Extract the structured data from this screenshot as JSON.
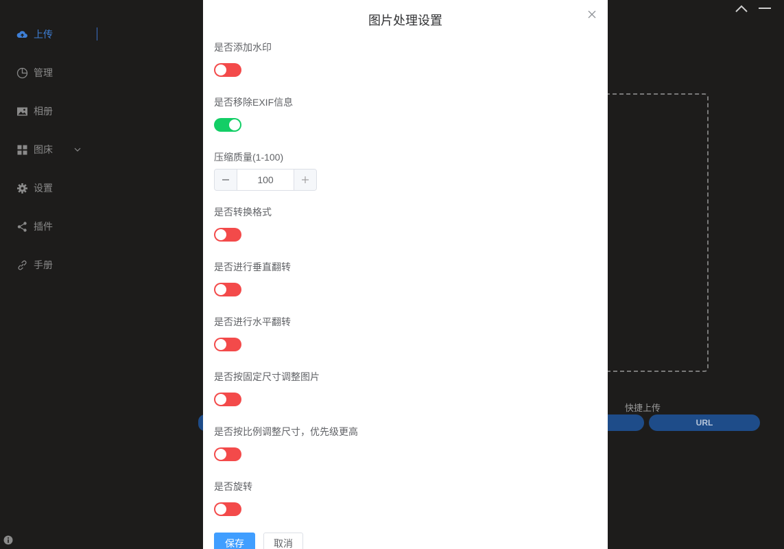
{
  "sidebar": {
    "items": [
      {
        "label": "上传",
        "icon": "cloud-upload-icon"
      },
      {
        "label": "管理",
        "icon": "pie-chart-icon"
      },
      {
        "label": "相册",
        "icon": "image-icon"
      },
      {
        "label": "图床",
        "icon": "grid-icon"
      },
      {
        "label": "设置",
        "icon": "gear-icon"
      },
      {
        "label": "插件",
        "icon": "share-icon"
      },
      {
        "label": "手册",
        "icon": "link-icon"
      }
    ],
    "active_color": "#3e7fd6"
  },
  "upload": {
    "quick_label": "快捷上传",
    "url_button": "URL"
  },
  "modal": {
    "title": "图片处理设置",
    "settings": [
      {
        "label": "是否添加水印",
        "enabled": false
      },
      {
        "label": "是否移除EXIF信息",
        "enabled": true
      },
      {
        "label": "压缩质量(1-100)",
        "value": "100"
      },
      {
        "label": "是否转换格式",
        "enabled": false
      },
      {
        "label": "是否进行垂直翻转",
        "enabled": false
      },
      {
        "label": "是否进行水平翻转",
        "enabled": false
      },
      {
        "label": "是否按固定尺寸调整图片",
        "enabled": false
      },
      {
        "label": "是否按比例调整尺寸，优先级更高",
        "enabled": false
      },
      {
        "label": "是否旋转",
        "enabled": false
      }
    ],
    "save_label": "保存",
    "cancel_label": "取消"
  },
  "colors": {
    "toggle_off": "#f34a4a",
    "toggle_on": "#13ce66",
    "primary": "#409eff"
  }
}
